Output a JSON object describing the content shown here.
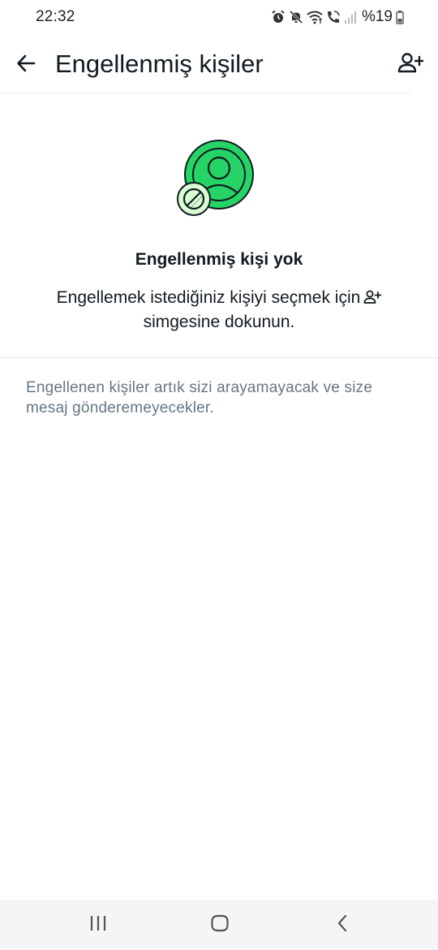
{
  "status_bar": {
    "time": "22:32",
    "battery": "%19",
    "icons": [
      "alarm-icon",
      "mute-icon",
      "wifi-icon",
      "wifi-call-icon",
      "signal-icon",
      "battery-icon"
    ]
  },
  "app_bar": {
    "title": "Engellenmiş kişiler",
    "back_icon": "arrow-left-icon",
    "add_icon": "person-add-icon"
  },
  "empty_state": {
    "title": "Engellenmiş kişi yok",
    "description": "Engellemek istediğiniz kişiyi seçmek için",
    "description_end": "simgesine dokunun.",
    "illustration_icon": "blocked-contact-icon",
    "accent_color": "#25d366"
  },
  "info": {
    "text": "Engellenen kişiler artık sizi arayamayacak ve size mesaj gönderemeyecekler."
  },
  "nav_bar": {
    "buttons": [
      "recents-icon",
      "home-icon",
      "back-nav-icon"
    ]
  }
}
